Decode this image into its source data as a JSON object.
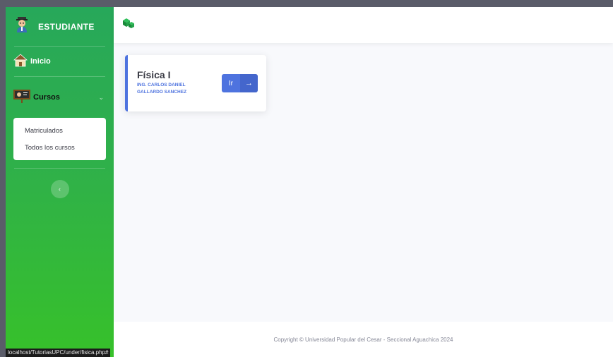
{
  "sidebar": {
    "brand_label": "ESTUDIANTE",
    "inicio_label": "Inicio",
    "cursos_label": "Cursos",
    "submenu": [
      {
        "label": "Matriculados"
      },
      {
        "label": "Todos los cursos"
      }
    ]
  },
  "course_card": {
    "title": "Física I",
    "teacher": "ING. CARLOS DANIEL GALLARDO SANCHEZ",
    "button_label": "Ir"
  },
  "footer": {
    "copyright": "Copyright © Universidad Popular del Cesar - Seccional Aguachica 2024"
  },
  "status_bar": {
    "url": "localhost/TutoriasUPC/under/fisica.php#"
  },
  "icons": {
    "brand": "student-icon",
    "inicio": "house-icon",
    "cursos": "blackboard-teacher-icon",
    "logo": "green-cubes-logo-icon",
    "toggle": "chevron-left-icon",
    "go": "arrow-right-icon"
  },
  "colors": {
    "sidebar_top": "#27a85a",
    "sidebar_bottom": "#37c12a",
    "accent": "#4e73df",
    "background": "#f8f9fc"
  }
}
